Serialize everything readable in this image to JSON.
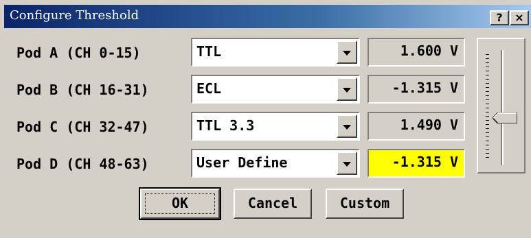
{
  "window": {
    "title": "Configure Threshold",
    "help_label": "?",
    "close_label": "×"
  },
  "pods": [
    {
      "label": "Pod A (CH 0-15)",
      "logic": "TTL",
      "voltage": "1.600 V"
    },
    {
      "label": "Pod B (CH 16-31)",
      "logic": "ECL",
      "voltage": "-1.315 V"
    },
    {
      "label": "Pod C (CH 32-47)",
      "logic": "TTL 3.3",
      "voltage": "1.490 V"
    },
    {
      "label": "Pod D (CH 48-63)",
      "logic": "User Define",
      "voltage": "-1.315 V"
    }
  ],
  "highlight_color": "#ffff00",
  "slider": {
    "level_fraction": 0.4
  },
  "buttons": {
    "ok": "OK",
    "cancel": "Cancel",
    "custom": "Custom"
  }
}
